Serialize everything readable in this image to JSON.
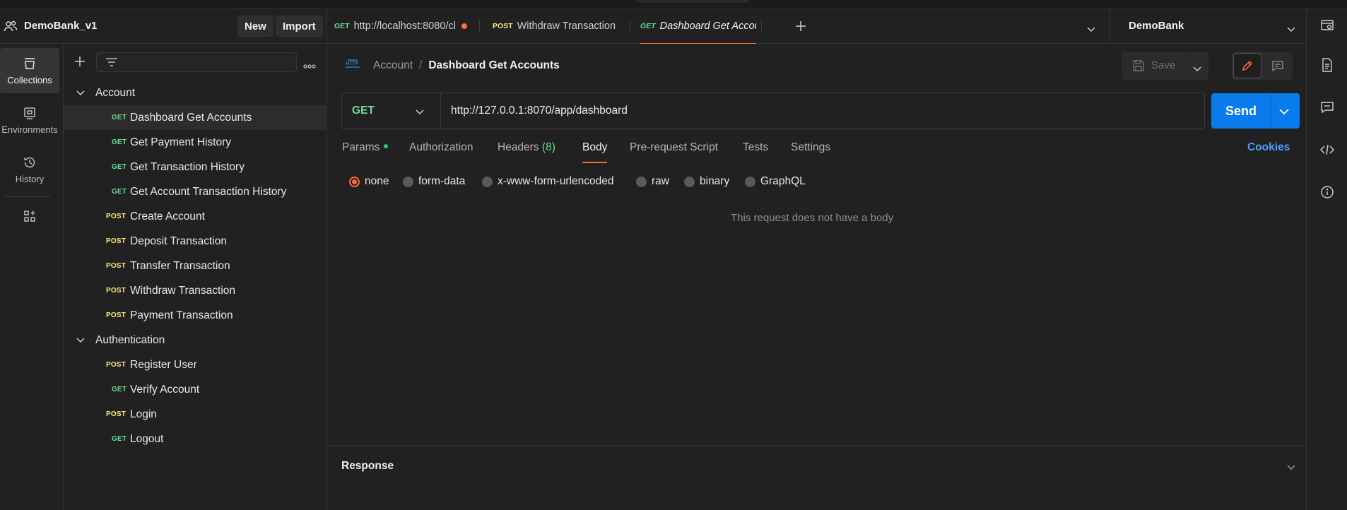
{
  "workspace": {
    "name": "DemoBank_v1",
    "new_label": "New",
    "import_label": "Import"
  },
  "rail": {
    "collections": "Collections",
    "environments": "Environments",
    "history": "History"
  },
  "tree": {
    "folders": [
      {
        "name": "Account",
        "requests": [
          {
            "method": "GET",
            "name": "Dashboard Get Accounts"
          },
          {
            "method": "GET",
            "name": "Get Payment History"
          },
          {
            "method": "GET",
            "name": "Get Transaction History"
          },
          {
            "method": "GET",
            "name": "Get Account Transaction History"
          },
          {
            "method": "POST",
            "name": "Create Account"
          },
          {
            "method": "POST",
            "name": "Deposit Transaction"
          },
          {
            "method": "POST",
            "name": "Transfer Transaction"
          },
          {
            "method": "POST",
            "name": "Withdraw Transaction"
          },
          {
            "method": "POST",
            "name": "Payment Transaction"
          }
        ]
      },
      {
        "name": "Authentication",
        "requests": [
          {
            "method": "POST",
            "name": "Register User"
          },
          {
            "method": "GET",
            "name": "Verify Account"
          },
          {
            "method": "POST",
            "name": "Login"
          },
          {
            "method": "GET",
            "name": "Logout"
          }
        ]
      }
    ]
  },
  "tabs": [
    {
      "method": "GET",
      "label": "http://localhost:8080/cl"
    },
    {
      "method": "POST",
      "label": "Withdraw Transaction"
    },
    {
      "method": "GET",
      "label": "Dashboard Get Accounts"
    }
  ],
  "environment": {
    "name": "DemoBank"
  },
  "request": {
    "breadcrumb_parent": "Account",
    "breadcrumb_sep": "/",
    "breadcrumb_title": "Dashboard Get Accounts",
    "save_label": "Save",
    "method": "GET",
    "url": "http://127.0.0.1:8070/app/dashboard",
    "send_label": "Send",
    "tabs": {
      "params": "Params",
      "authorization": "Authorization",
      "headers": "Headers",
      "headers_count": "(8)",
      "body": "Body",
      "prerequest": "Pre-request Script",
      "tests": "Tests",
      "settings": "Settings"
    },
    "cookies": "Cookies",
    "body_types": [
      "none",
      "form-data",
      "x-www-form-urlencoded",
      "raw",
      "binary",
      "GraphQL"
    ],
    "body_selected": "none",
    "empty_message": "This request does not have a body"
  },
  "response": {
    "title": "Response"
  },
  "colors": {
    "accent": "#ff6c37",
    "get": "#6bdd9a",
    "post": "#ffe47e",
    "send": "#097bed",
    "link": "#4aa3ff"
  }
}
